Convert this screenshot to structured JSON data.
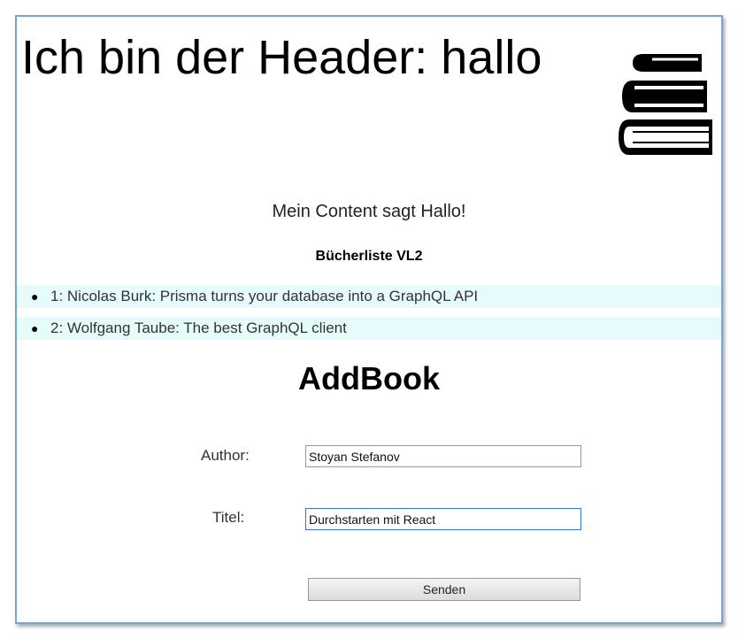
{
  "header": {
    "title": "Ich bin der Header: hallo",
    "logo_icon": "books-stack-icon"
  },
  "content": {
    "greeting": "Mein Content sagt Hallo!",
    "list_title": "Bücherliste VL2",
    "books": [
      {
        "text": "1: Nicolas Burk: Prisma turns your database into a GraphQL API"
      },
      {
        "text": "2: Wolfgang Taube: The best GraphQL client"
      }
    ]
  },
  "form": {
    "title": "AddBook",
    "author_label": "Author:",
    "author_value": "Stoyan Stefanov",
    "titel_label": "Titel:",
    "titel_value": "Durchstarten mit React",
    "submit_label": "Senden"
  },
  "colors": {
    "list_highlight": "#e6fbfb",
    "frame_border": "#7aa3d6",
    "focus_border": "#3b6fd1"
  }
}
